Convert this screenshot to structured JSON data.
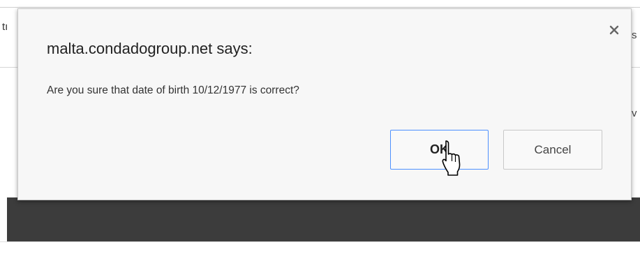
{
  "background": {
    "left_fragment": "tı",
    "right_fragment_top": "s",
    "right_fragment_mid": "v"
  },
  "dialog": {
    "title": "malta.condadogroup.net says:",
    "message": "Are you sure that date of birth 10/12/1977 is correct?",
    "ok_label": "OK",
    "cancel_label": "Cancel",
    "close_icon": "close-icon"
  },
  "colors": {
    "ok_border": "#4d90fe",
    "dark_band": "#3c3c3c",
    "dialog_bg": "#f7f7f7"
  }
}
